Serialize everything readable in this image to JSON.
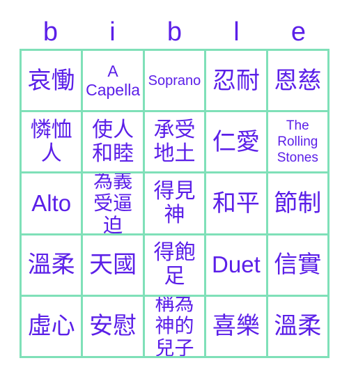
{
  "card": {
    "title_letters": [
      "b",
      "i",
      "b",
      "l",
      "e"
    ],
    "colors": {
      "text": "#5B1FE8",
      "border": "#7FE0B8",
      "background": "#FFFFFF"
    },
    "rows": [
      [
        {
          "text": "哀慟",
          "size": "sz-cjk2"
        },
        {
          "text": "A Capella",
          "size": "sz-lat-md"
        },
        {
          "text": "Soprano",
          "size": "sz-lat-sm"
        },
        {
          "text": "忍耐",
          "size": "sz-cjk2"
        },
        {
          "text": "恩慈",
          "size": "sz-cjk2"
        }
      ],
      [
        {
          "text": "憐恤人",
          "size": "sz-cjk3"
        },
        {
          "text": "使人和睦",
          "size": "sz-cjk3"
        },
        {
          "text": "承受地土",
          "size": "sz-cjk3"
        },
        {
          "text": "仁愛",
          "size": "sz-cjk2"
        },
        {
          "text": "The Rolling Stones",
          "size": "sz-lat-xs"
        }
      ],
      [
        {
          "text": "Alto",
          "size": "sz-lat-lg"
        },
        {
          "text": "為義受逼迫",
          "size": "sz-cjk4"
        },
        {
          "text": "得見神",
          "size": "sz-cjk3"
        },
        {
          "text": "和平",
          "size": "sz-cjk2"
        },
        {
          "text": "節制",
          "size": "sz-cjk2"
        }
      ],
      [
        {
          "text": "溫柔",
          "size": "sz-cjk2"
        },
        {
          "text": "天國",
          "size": "sz-cjk2"
        },
        {
          "text": "得飽足",
          "size": "sz-cjk3"
        },
        {
          "text": "Duet",
          "size": "sz-lat-lg"
        },
        {
          "text": "信實",
          "size": "sz-cjk2"
        }
      ],
      [
        {
          "text": "虛心",
          "size": "sz-cjk2"
        },
        {
          "text": "安慰",
          "size": "sz-cjk2"
        },
        {
          "text": "稱為神的兒子",
          "size": "sz-cjk4"
        },
        {
          "text": "喜樂",
          "size": "sz-cjk2"
        },
        {
          "text": "溫柔",
          "size": "sz-cjk2"
        }
      ]
    ]
  }
}
